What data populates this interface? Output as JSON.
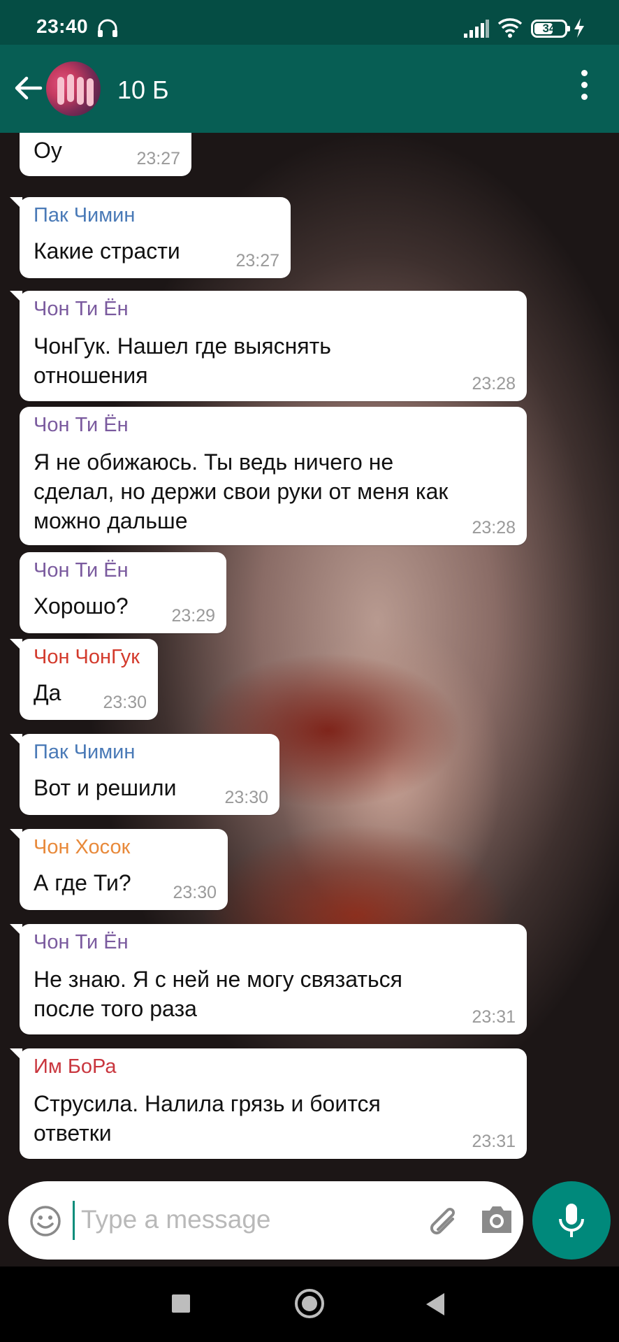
{
  "status_bar": {
    "time": "23:40",
    "battery": "34",
    "icons": [
      "headphones-icon",
      "signal-icon",
      "wifi-icon",
      "battery-icon",
      "charging-bolt-icon"
    ]
  },
  "header": {
    "title": "10 Б",
    "icons": [
      "back-arrow-icon",
      "group-avatar",
      "overflow-menu-icon"
    ]
  },
  "colors": {
    "header": "#075e54",
    "status_bar": "#054d44",
    "mic_button": "#00897b",
    "bubble": "#ffffff",
    "timestamp": "#9a9a9a"
  },
  "messages": [
    {
      "sender": "",
      "text": "Оу",
      "time": "23:27"
    },
    {
      "sender": "Пак Чимин",
      "sender_color": "#4a7ab7",
      "text": "Какие страсти",
      "time": "23:27"
    },
    {
      "sender": "Чон Ти Ён",
      "sender_color": "#7a5a9e",
      "text": "ЧонГук. Нашел где выяснять\nотношения",
      "time": "23:28"
    },
    {
      "sender": "Чон Ти Ён",
      "sender_color": "#7a5a9e",
      "text": "Я не обижаюсь. Ты ведь ничего не\nсделал, но держи свои руки от меня как\nможно дальше",
      "time": "23:28"
    },
    {
      "sender": "Чон Ти Ён",
      "sender_color": "#7a5a9e",
      "text": "Хорошо?",
      "time": "23:29"
    },
    {
      "sender": "Чон ЧонГук",
      "sender_color": "#d33a2c",
      "text": "Да",
      "time": "23:30"
    },
    {
      "sender": "Пак Чимин",
      "sender_color": "#4a7ab7",
      "text": "Вот и решили",
      "time": "23:30"
    },
    {
      "sender": "Чон Хосок",
      "sender_color": "#e8893a",
      "text": "А где Ти?",
      "time": "23:30"
    },
    {
      "sender": "Чон Ти Ён",
      "sender_color": "#7a5a9e",
      "text": "Не знаю. Я с ней не могу связаться\nпосле того раза",
      "time": "23:31"
    },
    {
      "sender": "Им БоРа",
      "sender_color": "#c9363e",
      "text": "Струсила. Налила грязь и боится\nответки",
      "time": "23:31"
    }
  ],
  "input": {
    "placeholder": "Type a message",
    "icons": [
      "emoji-icon",
      "attach-icon",
      "camera-icon",
      "mic-icon"
    ]
  },
  "nav_bar": {
    "icons": [
      "recents-icon",
      "home-icon",
      "back-icon"
    ]
  }
}
